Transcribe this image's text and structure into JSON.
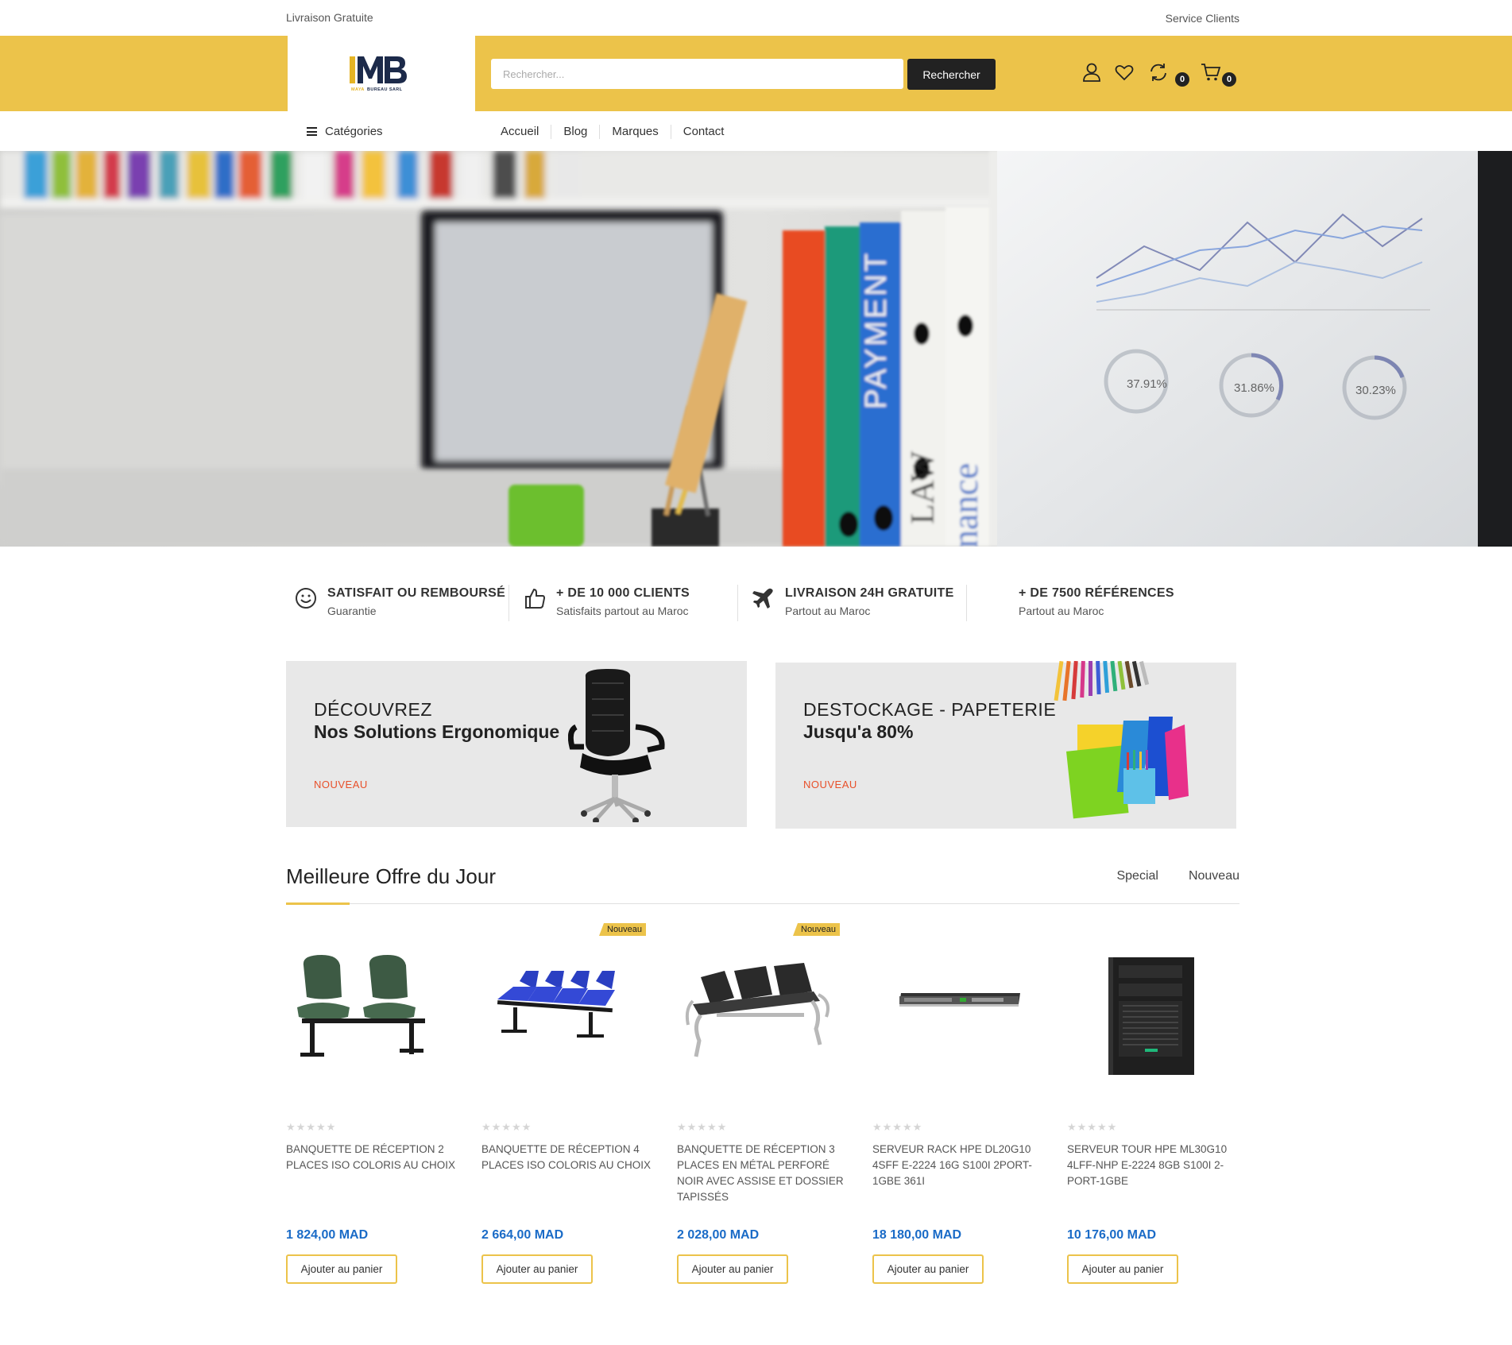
{
  "topbar": {
    "left": "Livraison Gratuite",
    "right": "Service Clients"
  },
  "brand": {
    "logo_text": "MAYA BUREAU SARL",
    "logo_letters": "MB"
  },
  "search": {
    "placeholder": "Rechercher...",
    "button": "Rechercher"
  },
  "header_icons": [
    {
      "icon": "user-icon"
    },
    {
      "icon": "heart-icon"
    },
    {
      "icon": "compare-icon",
      "count": "0"
    },
    {
      "icon": "cart-icon",
      "count": "0"
    }
  ],
  "nav": {
    "categories_label": "Catégories",
    "links": [
      "Accueil",
      "Blog",
      "Marques",
      "Contact"
    ]
  },
  "hero": {
    "chart_percentages": [
      "37.91%",
      "31.86%",
      "30.23%"
    ],
    "binder_labels": [
      "PAYMENT",
      "LAW",
      "nance"
    ]
  },
  "features": [
    {
      "icon": "smiley-icon",
      "title": "SATISFAIT OU REMBOURSÉ",
      "subtitle": "Guarantie"
    },
    {
      "icon": "thumbs-up-icon",
      "title": "+ DE 10 000 CLIENTS",
      "subtitle": "Satisfaits partout au Maroc"
    },
    {
      "icon": "plane-icon",
      "title": "LIVRAISON 24H GRATUITE",
      "subtitle": "Partout au Maroc"
    },
    {
      "icon": "",
      "title": "+ DE 7500 RÉFÉRENCES",
      "subtitle": "Partout au Maroc"
    }
  ],
  "banners": [
    {
      "line1": "DÉCOUVREZ",
      "line2": "Nos Solutions Ergonomique",
      "tag": "NOUVEAU"
    },
    {
      "line1": "DESTOCKAGE - PAPETERIE",
      "line2": "Jusqu'a 80%",
      "tag": "NOUVEAU"
    }
  ],
  "section": {
    "title": "Meilleure Offre du Jour",
    "tabs": [
      "Special",
      "Nouveau"
    ]
  },
  "products": [
    {
      "name": "BANQUETTE DE RÉCEPTION 2 PLACES ISO COLORIS AU CHOIX",
      "price": "1 824,00 MAD",
      "button": "Ajouter au panier",
      "tag": "",
      "rating": 0
    },
    {
      "name": "BANQUETTE DE RÉCEPTION 4 PLACES ISO COLORIS AU CHOIX",
      "price": "2 664,00 MAD",
      "button": "Ajouter au panier",
      "tag": "Nouveau",
      "rating": 0
    },
    {
      "name": "BANQUETTE DE RÉCEPTION 3 PLACES EN MÉTAL PERFORÉ NOIR AVEC ASSISE ET DOSSIER TAPISSÉS",
      "price": "2 028,00 MAD",
      "button": "Ajouter au panier",
      "tag": "Nouveau",
      "rating": 0
    },
    {
      "name": "SERVEUR RACK HPE DL20G10 4SFF E-2224 16G S100I 2PORT-1GBE 361I",
      "price": "18 180,00 MAD",
      "button": "Ajouter au panier",
      "tag": "",
      "rating": 0
    },
    {
      "name": "SERVEUR TOUR HPE ML30G10 4LFF-NHP E-2224 8GB S100I 2-PORT-1GBE",
      "price": "10 176,00 MAD",
      "button": "Ajouter au panier",
      "tag": "",
      "rating": 0
    }
  ],
  "colors": {
    "accent": "#ecc34a",
    "price": "#1a6bc7",
    "new_tag": "#e8502a",
    "dark": "#222222"
  }
}
